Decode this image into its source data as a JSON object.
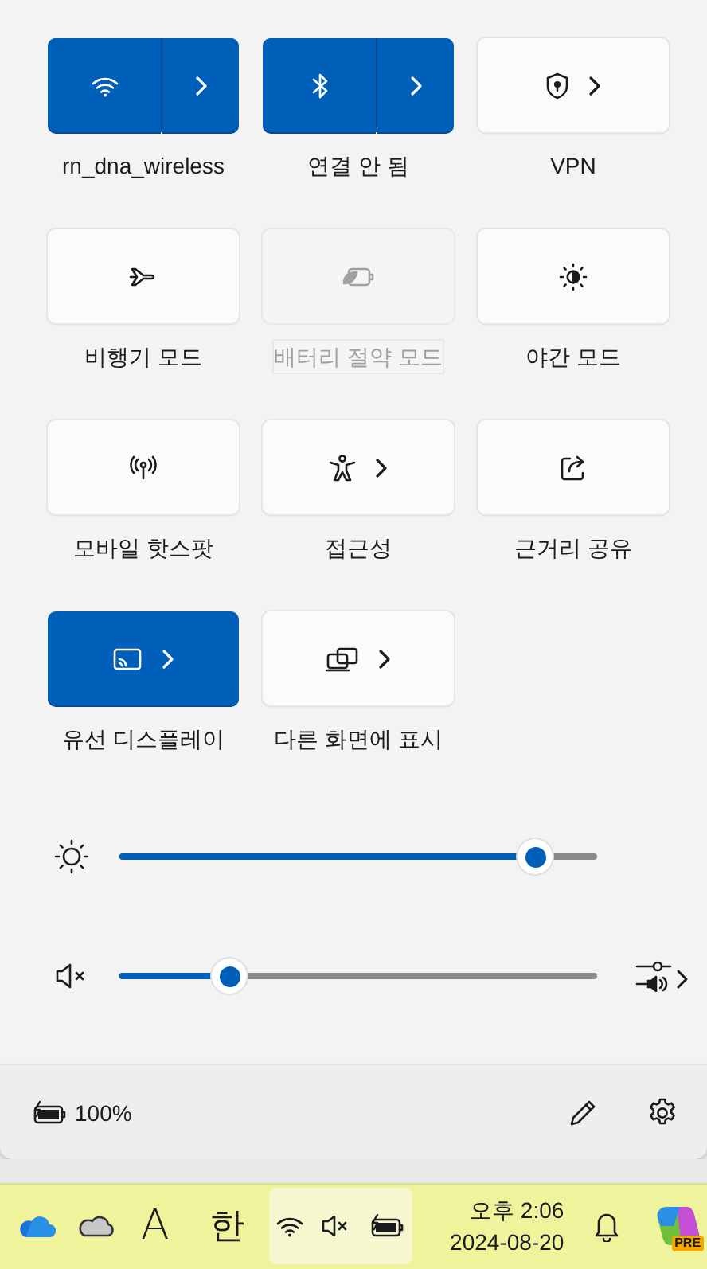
{
  "tiles": [
    {
      "kind": "split",
      "label": "rn_dna_wireless",
      "on": true,
      "disabled": false
    },
    {
      "kind": "split",
      "label": "연결 안 됨",
      "on": true,
      "disabled": false
    },
    {
      "kind": "expand",
      "label": "VPN",
      "on": false,
      "disabled": false
    },
    {
      "kind": "toggle",
      "label": "비행기 모드",
      "on": false,
      "disabled": false
    },
    {
      "kind": "toggle",
      "label": "배터리 절약 모드",
      "on": false,
      "disabled": true
    },
    {
      "kind": "toggle",
      "label": "야간 모드",
      "on": false,
      "disabled": false
    },
    {
      "kind": "toggle",
      "label": "모바일 핫스팟",
      "on": false,
      "disabled": false
    },
    {
      "kind": "expand",
      "label": "접근성",
      "on": false,
      "disabled": false
    },
    {
      "kind": "toggle",
      "label": "근거리 공유",
      "on": false,
      "disabled": false
    },
    {
      "kind": "expand",
      "label": "유선 디스플레이",
      "on": true,
      "disabled": false
    },
    {
      "kind": "expand",
      "label": "다른 화면에 표시",
      "on": false,
      "disabled": false
    }
  ],
  "sliders": [
    {
      "kind": "brightness",
      "level": 0.87
    },
    {
      "kind": "volume",
      "level": 0.23,
      "muted": true
    }
  ],
  "footer": {
    "battery": "100%"
  },
  "taskbar": {
    "keyboard": "A",
    "ime": "한",
    "time": "오후 2:06",
    "date": "2024-08-20",
    "copilot_badge": "PRE",
    "volume_muted": true
  }
}
